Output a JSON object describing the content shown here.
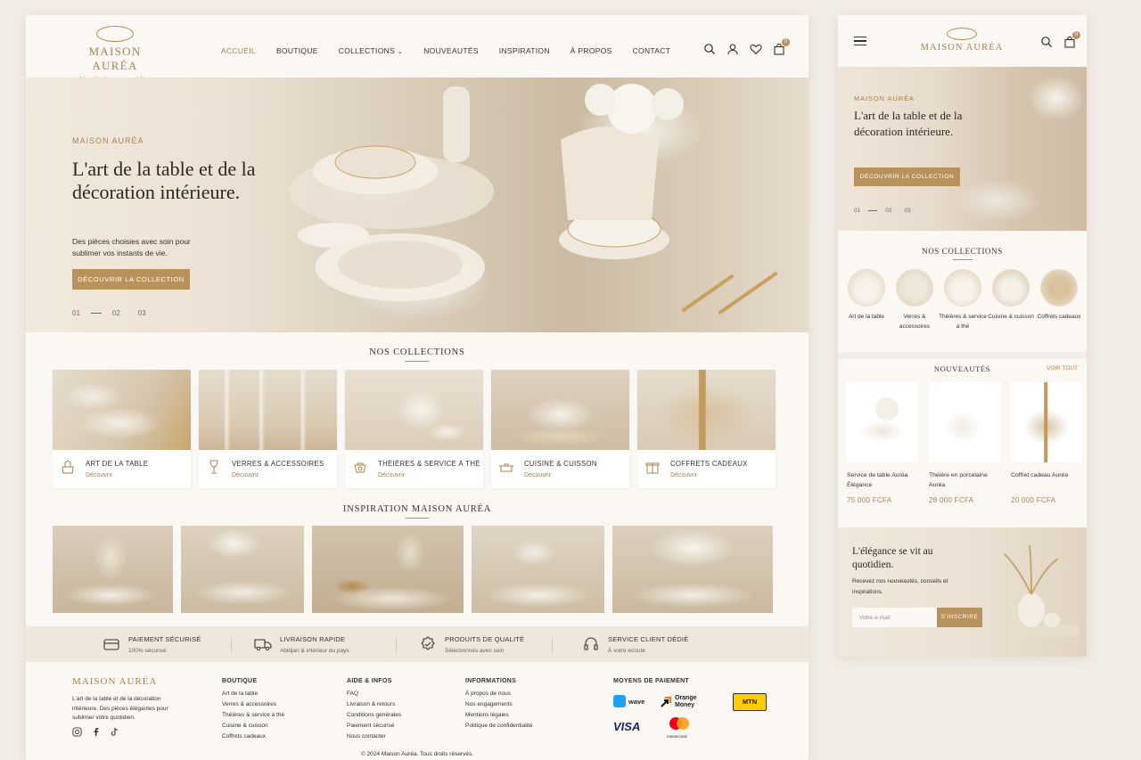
{
  "brand": {
    "name": "MAISON AURÉA",
    "tagline": "L'art de vivre au quotidien"
  },
  "nav": {
    "items": [
      {
        "label": "ACCUEIL",
        "active": true
      },
      {
        "label": "BOUTIQUE"
      },
      {
        "label": "COLLECTIONS",
        "dropdown": true
      },
      {
        "label": "NOUVEAUTÉS"
      },
      {
        "label": "INSPIRATION"
      },
      {
        "label": "À PROPOS"
      },
      {
        "label": "CONTACT"
      }
    ],
    "icons": [
      "search-icon",
      "user-icon",
      "heart-icon",
      "bag-icon"
    ],
    "cart_count": "0"
  },
  "hero": {
    "eyebrow": "MAISON AURÉA",
    "title": "L'art de la table et de la décoration intérieure.",
    "subtitle": "Des pièces choisies avec soin pour sublimer vos instants de vie.",
    "cta": "DÉCOUVRIR LA COLLECTION",
    "slides": [
      "01",
      "02",
      "03"
    ]
  },
  "collections": {
    "title": "NOS COLLECTIONS",
    "link_label": "Découvrir",
    "items": [
      {
        "name": "ART DE LA TABLE",
        "icon": "place-setting-icon"
      },
      {
        "name": "VERRES & ACCESSOIRES",
        "icon": "wine-glass-icon"
      },
      {
        "name": "THÉIÈRES & SERVICE À THÉ",
        "icon": "teapot-icon"
      },
      {
        "name": "CUISINE & CUISSON",
        "icon": "cooking-pot-icon"
      },
      {
        "name": "COFFRETS CADEAUX",
        "icon": "gift-icon"
      }
    ]
  },
  "inspiration": {
    "title": "INSPIRATION MAISON AURÉA"
  },
  "features": [
    {
      "title": "PAIEMENT SÉCURISÉ",
      "sub": "100% sécurisé",
      "icon": "credit-card-icon"
    },
    {
      "title": "LIVRAISON RAPIDE",
      "sub": "Abidjan & intérieur du pays",
      "icon": "truck-icon"
    },
    {
      "title": "PRODUITS DE QUALITÉ",
      "sub": "Sélectionnés avec soin",
      "icon": "quality-badge-icon"
    },
    {
      "title": "SERVICE CLIENT DÉDIÉ",
      "sub": "À votre écoute",
      "icon": "headset-icon"
    }
  ],
  "footer": {
    "brand": "MAISON AURÉA",
    "description": "L'art de la table et de la décoration intérieure. Des pièces élégantes pour sublimer votre quotidien.",
    "social": [
      "instagram-icon",
      "facebook-icon",
      "tiktok-icon"
    ],
    "columns": [
      {
        "heading": "BOUTIQUE",
        "links": [
          "Art de la table",
          "Verres & accessoires",
          "Théières & service à thé",
          "Cuisine & cuisson",
          "Coffrets cadeaux"
        ]
      },
      {
        "heading": "AIDE & INFOS",
        "links": [
          "FAQ",
          "Livraison & retours",
          "Conditions générales",
          "Paiement sécurisé",
          "Nous contacter"
        ]
      },
      {
        "heading": "INFORMATIONS",
        "links": [
          "À propos de nous",
          "Nos engagements",
          "Mentions légales",
          "Politique de confidentialité"
        ]
      }
    ],
    "payments": {
      "heading": "MOYENS DE PAIEMENT",
      "wave": "wave",
      "orange": "Orange Money",
      "mtn": "MTN",
      "visa": "VISA",
      "mastercard": "mastercard"
    },
    "copyright": "© 2024 Maison Auréa. Tous droits réservés."
  },
  "mobile": {
    "hero_title": "L'art de la table et de la décoration intérieure.",
    "collections": [
      {
        "label": "Art de la table"
      },
      {
        "label": "Verres & accessoires"
      },
      {
        "label": "Théières & service à thé"
      },
      {
        "label": "Cuisine & cuisson"
      },
      {
        "label": "Coffrets cadeaux"
      }
    ],
    "new_title": "NOUVEAUTÉS",
    "see_all": "VOIR TOUT",
    "products": [
      {
        "name": "Service de table Auréa Élégance",
        "price": "75 000 FCFA"
      },
      {
        "name": "Théière en porcelaine Auréa",
        "price": "28 000 FCFA"
      },
      {
        "name": "Coffret cadeau Auréa",
        "price": "20 000 FCFA"
      }
    ],
    "newsletter": {
      "title": "L'élégance se vit au quotidien.",
      "desc": "Recevez nos nouveautés, conseils et inspirations.",
      "placeholder": "Votre e-mail",
      "button": "S'INSCRIRE"
    }
  },
  "colors": {
    "accent": "#b8925c",
    "gold_text": "#a98150",
    "background": "#fbf8f4",
    "band": "#efe7dc"
  }
}
